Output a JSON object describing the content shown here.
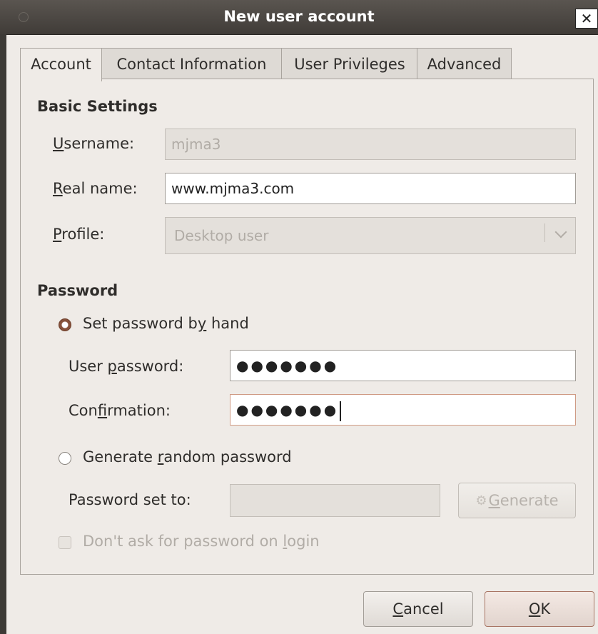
{
  "window": {
    "title": "New user account",
    "close_label": "✕"
  },
  "tabs": [
    {
      "label": "Account",
      "active": true
    },
    {
      "label": "Contact Information",
      "active": false
    },
    {
      "label": "User Privileges",
      "active": false
    },
    {
      "label": "Advanced",
      "active": false
    }
  ],
  "basic_settings": {
    "heading": "Basic Settings",
    "username": {
      "label_mnemonic": "U",
      "label_rest": "sername:",
      "value": "mjma3"
    },
    "real_name": {
      "label_mnemonic": "R",
      "label_rest": "eal name:",
      "value": "www.mjma3.com"
    },
    "profile": {
      "label_mnemonic": "P",
      "label_rest": "rofile:",
      "value": "Desktop user"
    }
  },
  "password": {
    "heading": "Password",
    "set_by_hand": {
      "pre": "Set password b",
      "mnemonic": "y",
      "post": " hand",
      "selected": true
    },
    "user_password": {
      "pre": "User ",
      "mnemonic": "p",
      "post": "assword:",
      "value": "●●●●●●●"
    },
    "confirmation": {
      "pre": "Con",
      "mnemonic": "f",
      "post": "irmation:",
      "value": "●●●●●●●"
    },
    "generate_random": {
      "pre": "Generate ",
      "mnemonic": "r",
      "post": "andom password",
      "selected": false
    },
    "password_set_to": {
      "label": "Password set to:",
      "value": ""
    },
    "generate_button": {
      "mnemonic": "G",
      "rest": "enerate",
      "icon": "gear-icon"
    },
    "dont_ask": {
      "pre": "Don't ask for password on ",
      "mnemonic": "l",
      "post": "ogin",
      "checked": false
    }
  },
  "buttons": {
    "cancel": {
      "mnemonic": "C",
      "rest": "ancel"
    },
    "ok": {
      "mnemonic": "O",
      "rest": "K"
    }
  },
  "colors": {
    "radio_selected": "#87523a",
    "focus_border": "#cf9a84",
    "titlebar": "#4a4642"
  }
}
